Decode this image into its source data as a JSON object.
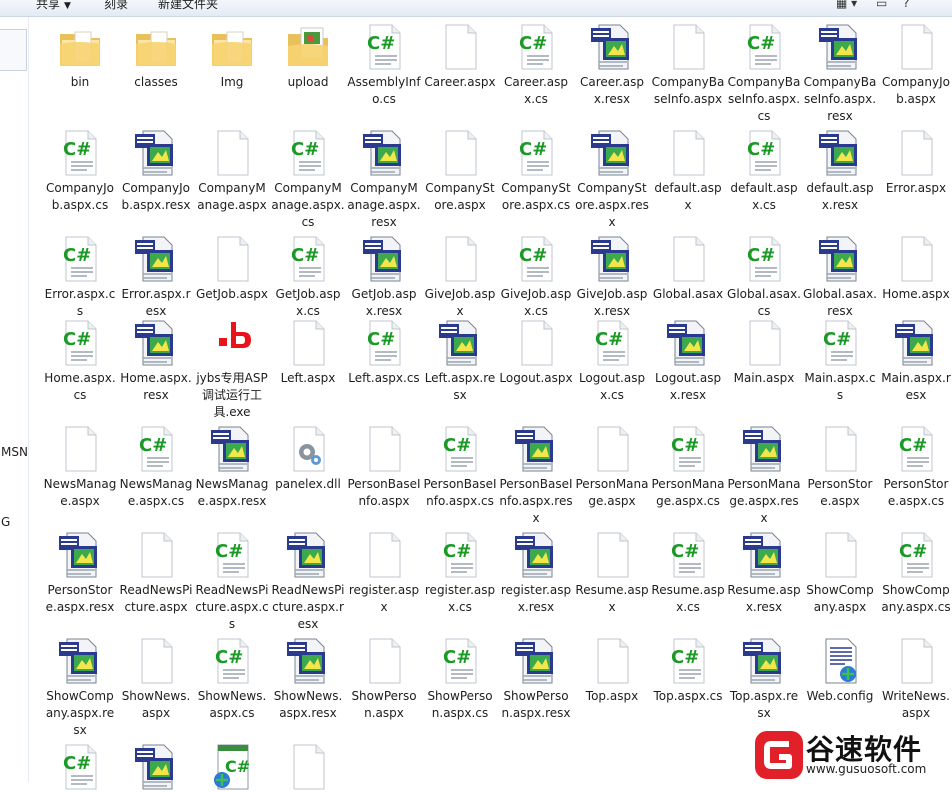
{
  "toolbar": {
    "share_label": "共享",
    "burn_label": "刻录",
    "new_folder_label": "新建文件夹"
  },
  "nav": {
    "item_msn": "MSN",
    "item_g": "G"
  },
  "files": [
    {
      "name": "bin",
      "type": "folder"
    },
    {
      "name": "classes",
      "type": "folder"
    },
    {
      "name": "Img",
      "type": "folder"
    },
    {
      "name": "upload",
      "type": "folder-img"
    },
    {
      "name": "AssemblyInfo.cs",
      "type": "cs"
    },
    {
      "name": "Career.aspx",
      "type": "aspx"
    },
    {
      "name": "Career.aspx.cs",
      "type": "cs"
    },
    {
      "name": "Career.aspx.resx",
      "type": "resx"
    },
    {
      "name": "CompanyBaseInfo.aspx",
      "type": "aspx"
    },
    {
      "name": "CompanyBaseInfo.aspx.cs",
      "type": "cs"
    },
    {
      "name": "CompanyBaseInfo.aspx.resx",
      "type": "resx"
    },
    {
      "name": "CompanyJob.aspx",
      "type": "aspx"
    },
    {
      "name": "CompanyJob.aspx.cs",
      "type": "cs"
    },
    {
      "name": "CompanyJob.aspx.resx",
      "type": "resx"
    },
    {
      "name": "CompanyManage.aspx",
      "type": "aspx"
    },
    {
      "name": "CompanyManage.aspx.cs",
      "type": "cs"
    },
    {
      "name": "CompanyManage.aspx.resx",
      "type": "resx"
    },
    {
      "name": "CompanyStore.aspx",
      "type": "aspx"
    },
    {
      "name": "CompanyStore.aspx.cs",
      "type": "cs"
    },
    {
      "name": "CompanyStore.aspx.resx",
      "type": "resx"
    },
    {
      "name": "default.aspx",
      "type": "aspx"
    },
    {
      "name": "default.aspx.cs",
      "type": "cs"
    },
    {
      "name": "default.aspx.resx",
      "type": "resx"
    },
    {
      "name": "Error.aspx",
      "type": "aspx"
    },
    {
      "name": "Error.aspx.cs",
      "type": "cs"
    },
    {
      "name": "Error.aspx.resx",
      "type": "resx"
    },
    {
      "name": "GetJob.aspx",
      "type": "aspx"
    },
    {
      "name": "GetJob.aspx.cs",
      "type": "cs"
    },
    {
      "name": "GetJob.aspx.resx",
      "type": "resx"
    },
    {
      "name": "GiveJob.aspx",
      "type": "aspx"
    },
    {
      "name": "GiveJob.aspx.cs",
      "type": "cs"
    },
    {
      "name": "GiveJob.aspx.resx",
      "type": "resx"
    },
    {
      "name": "Global.asax",
      "type": "aspx"
    },
    {
      "name": "Global.asax.cs",
      "type": "cs"
    },
    {
      "name": "Global.asax.resx",
      "type": "resx"
    },
    {
      "name": "Home.aspx",
      "type": "aspx"
    },
    {
      "name": "Home.aspx.cs",
      "type": "cs"
    },
    {
      "name": "Home.aspx.resx",
      "type": "resx"
    },
    {
      "name": "jybs专用ASP调试运行工具.exe",
      "type": "exe"
    },
    {
      "name": "Left.aspx",
      "type": "aspx"
    },
    {
      "name": "Left.aspx.cs",
      "type": "cs"
    },
    {
      "name": "Left.aspx.resx",
      "type": "resx"
    },
    {
      "name": "Logout.aspx",
      "type": "aspx"
    },
    {
      "name": "Logout.aspx.cs",
      "type": "cs"
    },
    {
      "name": "Logout.aspx.resx",
      "type": "resx"
    },
    {
      "name": "Main.aspx",
      "type": "aspx"
    },
    {
      "name": "Main.aspx.cs",
      "type": "cs"
    },
    {
      "name": "Main.aspx.resx",
      "type": "resx"
    },
    {
      "name": "NewsManage.aspx",
      "type": "aspx"
    },
    {
      "name": "NewsManage.aspx.cs",
      "type": "cs"
    },
    {
      "name": "NewsManage.aspx.resx",
      "type": "resx"
    },
    {
      "name": "panelex.dll",
      "type": "dll"
    },
    {
      "name": "PersonBaseInfo.aspx",
      "type": "aspx"
    },
    {
      "name": "PersonBaseInfo.aspx.cs",
      "type": "cs"
    },
    {
      "name": "PersonBaseInfo.aspx.resx",
      "type": "resx"
    },
    {
      "name": "PersonManage.aspx",
      "type": "aspx"
    },
    {
      "name": "PersonManage.aspx.cs",
      "type": "cs"
    },
    {
      "name": "PersonManage.aspx.resx",
      "type": "resx"
    },
    {
      "name": "PersonStore.aspx",
      "type": "aspx"
    },
    {
      "name": "PersonStore.aspx.cs",
      "type": "cs"
    },
    {
      "name": "PersonStore.aspx.resx",
      "type": "resx"
    },
    {
      "name": "ReadNewsPicture.aspx",
      "type": "aspx"
    },
    {
      "name": "ReadNewsPicture.aspx.cs",
      "type": "cs"
    },
    {
      "name": "ReadNewsPicture.aspx.resx",
      "type": "resx"
    },
    {
      "name": "register.aspx",
      "type": "aspx"
    },
    {
      "name": "register.aspx.cs",
      "type": "cs"
    },
    {
      "name": "register.aspx.resx",
      "type": "resx"
    },
    {
      "name": "Resume.aspx",
      "type": "aspx"
    },
    {
      "name": "Resume.aspx.cs",
      "type": "cs"
    },
    {
      "name": "Resume.aspx.resx",
      "type": "resx"
    },
    {
      "name": "ShowCompany.aspx",
      "type": "aspx"
    },
    {
      "name": "ShowCompany.aspx.cs",
      "type": "cs"
    },
    {
      "name": "ShowCompany.aspx.resx",
      "type": "resx"
    },
    {
      "name": "ShowNews.aspx",
      "type": "aspx"
    },
    {
      "name": "ShowNews.aspx.cs",
      "type": "cs"
    },
    {
      "name": "ShowNews.aspx.resx",
      "type": "resx"
    },
    {
      "name": "ShowPerson.aspx",
      "type": "aspx"
    },
    {
      "name": "ShowPerson.aspx.cs",
      "type": "cs"
    },
    {
      "name": "ShowPerson.aspx.resx",
      "type": "resx"
    },
    {
      "name": "Top.aspx",
      "type": "aspx"
    },
    {
      "name": "Top.aspx.cs",
      "type": "cs"
    },
    {
      "name": "Top.aspx.resx",
      "type": "resx"
    },
    {
      "name": "Web.config",
      "type": "config"
    },
    {
      "name": "WriteNews.aspx",
      "type": "aspx"
    },
    {
      "name": "",
      "type": "cs"
    },
    {
      "name": "",
      "type": "resx"
    },
    {
      "name": "",
      "type": "cs-web"
    },
    {
      "name": "",
      "type": "aspx"
    }
  ],
  "watermark": {
    "text": "谷速软件",
    "url": "www.gusuosoft.com",
    "brand_color": "#e2202a"
  }
}
